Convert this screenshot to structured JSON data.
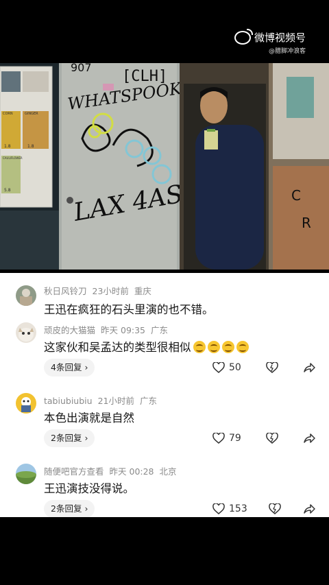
{
  "watermark": {
    "brand": "微博视频号",
    "user": "@腊脚冲浪客"
  },
  "scene": {
    "graffiti_tag": "[CLH]",
    "graffiti_numbers": "907",
    "graffiti_big": "WHATSPOOK",
    "graffiti_lower": "LAX 4AS",
    "poster_labels": [
      "CORN",
      "GINGER",
      "CAULIFLOWER"
    ],
    "poster_prices": [
      "1.8",
      "1.8",
      "5.8"
    ]
  },
  "comments": [
    {
      "user": "秋日风铃刀",
      "time": "23小时前",
      "location": "重庆",
      "text": "王迅在疯狂的石头里演的也不错。"
    },
    {
      "user": "顽皮的大猫猫",
      "time": "昨天 09:35",
      "location": "广东",
      "text": "这家伙和吴孟达的类型很相似",
      "emoji_count": 4,
      "replies": "4条回复",
      "likes": "50"
    },
    {
      "user": "tabiubiubiu",
      "time": "21小时前",
      "location": "广东",
      "text": "本色出演就是自然",
      "replies": "2条回复",
      "likes": "79"
    },
    {
      "user": "随便吧官方查看",
      "time": "昨天 00:28",
      "location": "北京",
      "text": "王迅演技没得说。",
      "replies": "2条回复",
      "likes": "153"
    }
  ],
  "colors": {
    "accent_emoji": "#f7c630",
    "meta_gray": "#8a8a8a"
  }
}
